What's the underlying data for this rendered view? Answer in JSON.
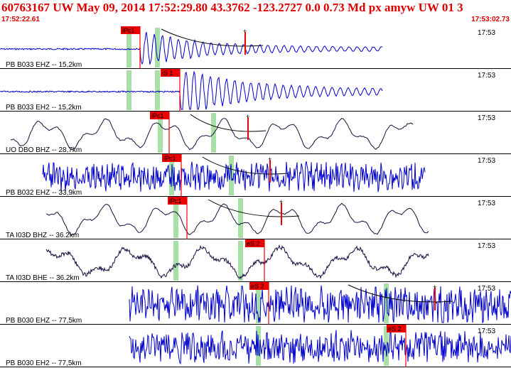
{
  "header": {
    "title": "60763167 UW May 09, 2014 17:52:29.80   43.3762 -123.2727  0.0 0.73 Md px amyw UW 01   3",
    "start_time": "17:52:22.61",
    "end_time": "17:53:02.73"
  },
  "colors": {
    "header_text": "#dd0000",
    "trace_blue": "#0000cc",
    "trace_dark": "#1a0d40",
    "pick": "#ee0000",
    "window": "#a8e0a8",
    "separator": "#000000"
  },
  "traces": [
    {
      "label": "PB B033 EHZ -- 15,2km",
      "time_label": "17:53",
      "color": "blue",
      "pick": {
        "label": "iPc1"
      },
      "windows": [
        0.25,
        0.3
      ],
      "amp": 0.35,
      "style": "quake",
      "span": [
        0.0,
        0.75
      ],
      "hasEnd": true
    },
    {
      "label": "PB B033 EH2 -- 15,2km",
      "time_label": "17:53",
      "color": "blue",
      "pick": {
        "label": "iS 1"
      },
      "windows": [
        0.25,
        0.3
      ],
      "amp": 0.45,
      "style": "quake2",
      "span": [
        0.0,
        0.75
      ],
      "hasEnd": false
    },
    {
      "label": "UO DBO BHZ -- 28,7km",
      "time_label": "17:53",
      "color": "dark",
      "pick": {
        "label": "iPc1"
      },
      "windows": [
        0.31,
        0.41
      ],
      "amp": 0.35,
      "style": "smooth",
      "span": [
        0.02,
        0.81
      ],
      "hasEnd": true
    },
    {
      "label": "PB B032 EHZ -- 33,9km",
      "time_label": "17:53",
      "color": "blue",
      "pick": {
        "label": "iPc1"
      },
      "windows": [
        0.33,
        0.45
      ],
      "amp": 0.35,
      "style": "noisy",
      "span": [
        0.08,
        0.83
      ],
      "hasEnd": true
    },
    {
      "label": "TA I03D BHZ -- 36.2km",
      "time_label": "17:53",
      "color": "dark",
      "pick": {
        "label": "iPc1"
      },
      "windows": [
        0.34,
        0.47
      ],
      "amp": 0.35,
      "style": "smooth",
      "span": [
        0.09,
        0.84
      ],
      "hasEnd": true
    },
    {
      "label": "TA I03D BHE -- 36.2km",
      "time_label": "17:53",
      "color": "dark",
      "pick": {
        "label": "eS 2"
      },
      "windows": [
        0.34,
        0.47
      ],
      "amp": 0.35,
      "style": "rough",
      "span": [
        0.09,
        0.84
      ],
      "hasEnd": false
    },
    {
      "label": "PB B030 EHZ -- 77,5km",
      "time_label": "17:53",
      "color": "blue",
      "pick": {
        "label": "eS 2"
      },
      "windows": [
        0.5,
        0.75
      ],
      "amp": 0.45,
      "style": "noisy",
      "span": [
        0.25,
        1.0
      ],
      "hasEnd": true
    },
    {
      "label": "PB B030 EH2 -- 77,5km",
      "time_label": "17:53",
      "color": "blue",
      "pick": {
        "label": "eS 2"
      },
      "windows": [
        0.5,
        0.75
      ],
      "amp": 0.4,
      "style": "noisy",
      "span": [
        0.25,
        1.0
      ],
      "hasEnd": false
    }
  ]
}
